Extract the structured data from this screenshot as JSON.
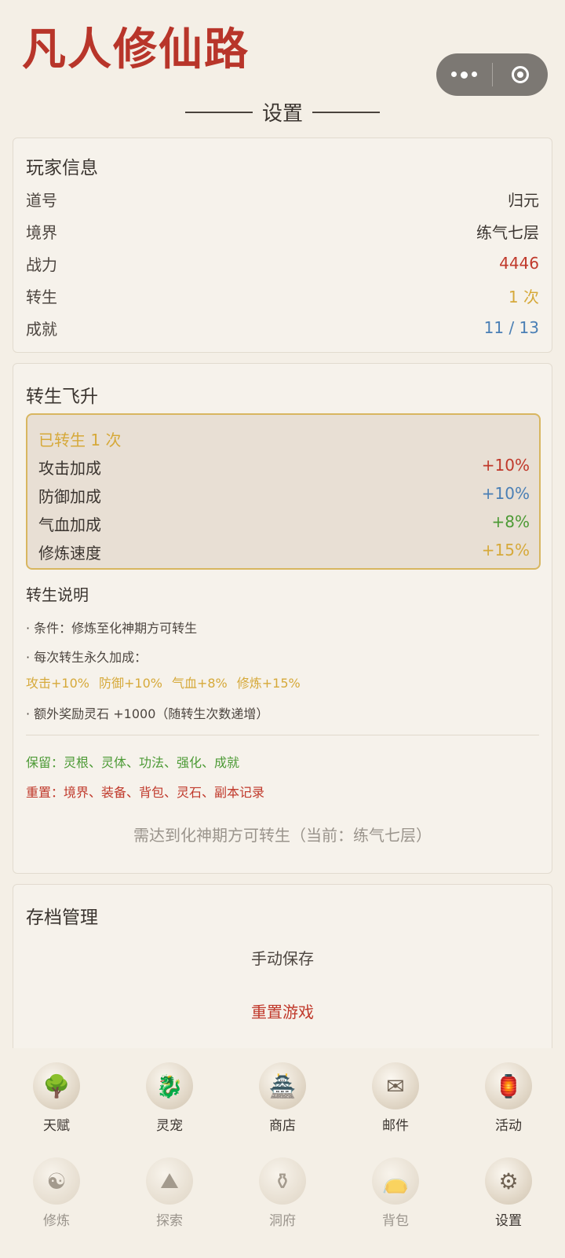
{
  "app": {
    "title": "凡人修仙路"
  },
  "page": {
    "title": "设置"
  },
  "player_info": {
    "title": "玩家信息",
    "rows": [
      {
        "label": "道号",
        "value": "归元",
        "color": "#3b3530"
      },
      {
        "label": "境界",
        "value": "练气七层",
        "color": "#3b3530"
      },
      {
        "label": "战力",
        "value": "4446",
        "color": "#c0392b"
      },
      {
        "label": "转生",
        "value": "1 次",
        "color": "#d6a93a"
      },
      {
        "label": "成就",
        "value": "11 / 13",
        "color": "#4a7fb5"
      }
    ]
  },
  "rebirth": {
    "title": "转生飞升",
    "status": "已转生 1 次",
    "bonuses": [
      {
        "label": "攻击加成",
        "value": "+10%",
        "color": "#c0392b"
      },
      {
        "label": "防御加成",
        "value": "+10%",
        "color": "#4a7fb5"
      },
      {
        "label": "气血加成",
        "value": "+8%",
        "color": "#4c9a35"
      },
      {
        "label": "修炼速度",
        "value": "+15%",
        "color": "#d6a93a"
      }
    ],
    "explanation_title": "转生说明",
    "condition": "· 条件：修炼至化神期方可转生",
    "per_rebirth": "· 每次转生永久加成：",
    "bonus_items": [
      "攻击+10%",
      "防御+10%",
      "气血+8%",
      "修炼+15%"
    ],
    "extra_reward": "· 额外奖励灵石 +1000（随转生次数递增）",
    "keep": "保留：灵根、灵体、功法、强化、成就",
    "reset": "重置：境界、装备、背包、灵石、副本记录",
    "requirement": "需达到化神期方可转生（当前：练气七层）"
  },
  "save": {
    "title": "存档管理",
    "manual_save": "手动保存",
    "reset_game": "重置游戏"
  },
  "nav": {
    "items": [
      {
        "label": "天赋",
        "icon": "talent-tree-icon",
        "glyph": "🌳",
        "dim": false
      },
      {
        "label": "灵宠",
        "icon": "spirit-pet-icon",
        "glyph": "🐉",
        "dim": false
      },
      {
        "label": "商店",
        "icon": "shop-icon",
        "glyph": "🏯",
        "dim": false
      },
      {
        "label": "邮件",
        "icon": "mail-icon",
        "glyph": "✉",
        "dim": false
      },
      {
        "label": "活动",
        "icon": "event-lantern-icon",
        "glyph": "🏮",
        "dim": false
      },
      {
        "label": "修炼",
        "icon": "cultivate-icon",
        "glyph": "☯",
        "dim": true
      },
      {
        "label": "探索",
        "icon": "explore-mountain-icon",
        "glyph": "⛰",
        "dim": true
      },
      {
        "label": "洞府",
        "icon": "cave-cauldron-icon",
        "glyph": "⚱",
        "dim": true
      },
      {
        "label": "背包",
        "icon": "bag-icon",
        "glyph": "👝",
        "dim": true
      },
      {
        "label": "设置",
        "icon": "settings-gear-icon",
        "glyph": "⚙",
        "dim": false
      }
    ]
  }
}
